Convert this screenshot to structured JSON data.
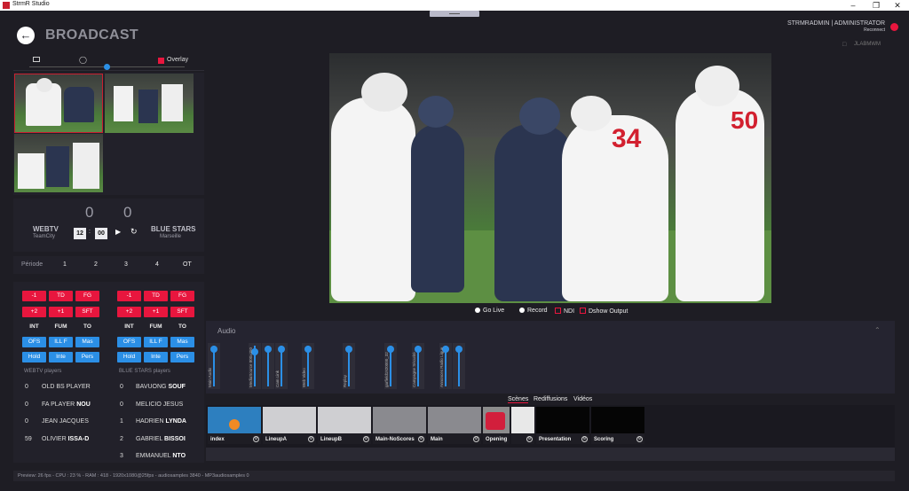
{
  "window": {
    "title": "StrmR Studio",
    "min": "–",
    "max": "❐",
    "close": "✕"
  },
  "header": {
    "title": "BROADCAST",
    "user": "STRMRADMIN | ADMINISTRATOR",
    "reconnect": "Reconnect",
    "status_color": "#e8163e"
  },
  "right_info": {
    "code": "JLABMWM"
  },
  "sources": {
    "overlay_label": "Overlay"
  },
  "scoreboard": {
    "home": {
      "name": "WEBTV",
      "city": "TeamCity",
      "score": "0"
    },
    "away": {
      "name": "BLUE STARS",
      "city": "Marseille",
      "score": "0"
    },
    "clock_min": "12",
    "clock_sec": "00"
  },
  "periode": {
    "label": "Période",
    "items": [
      "1",
      "2",
      "3",
      "4",
      "OT"
    ]
  },
  "actions": {
    "rows": [
      [
        "-1",
        "TD",
        "FG"
      ],
      [
        "+2",
        "+1",
        "SFT"
      ],
      [
        "INT",
        "FUM",
        "TO"
      ],
      [
        "OFS",
        "ILL F",
        "Mas"
      ],
      [
        "Hold",
        "Inte",
        "Pers"
      ]
    ]
  },
  "home_players": {
    "title": "WEBTV players",
    "list": [
      {
        "num": "0",
        "first": "OLD BS PLAYER",
        "last": ""
      },
      {
        "num": "0",
        "first": "FA PLAYER",
        "last": "NOU"
      },
      {
        "num": "0",
        "first": "JEAN JACQUES",
        "last": ""
      },
      {
        "num": "59",
        "first": "OLIVIER",
        "last": "ISSA-D"
      }
    ]
  },
  "away_players": {
    "title": "BLUE STARS players",
    "list": [
      {
        "num": "0",
        "first": "BAVUONG",
        "last": "SOUF"
      },
      {
        "num": "0",
        "first": "MELICIO JESUS",
        "last": ""
      },
      {
        "num": "1",
        "first": "HADRIEN",
        "last": "LYNDA"
      },
      {
        "num": "2",
        "first": "GABRIEL",
        "last": "BISSOI"
      },
      {
        "num": "3",
        "first": "EMMANUEL",
        "last": "NTO"
      }
    ]
  },
  "outputs": {
    "go_live": "Go Live",
    "record": "Record",
    "ndi": "NDI",
    "dshow": "Dshow Output"
  },
  "audio": {
    "title": "Audio",
    "channels": [
      {
        "label": "Main Audio",
        "level": 0.02
      },
      {
        "label": "MediaSource 800x450",
        "level": 0.1
      },
      {
        "label": "Cam Link",
        "level": 0.02
      },
      {
        "label": "Web Video",
        "level": 0.02
      },
      {
        "label": "Replay",
        "level": 0.02
      },
      {
        "label": "garfield1920000_32",
        "level": 0.02
      },
      {
        "label": "Campagne Sécurité",
        "level": 0.02
      },
      {
        "label": "Annonces Radio Ligue",
        "level": 0.02
      },
      {
        "label": "",
        "level": 0.02
      }
    ]
  },
  "scene_tabs": [
    "Scènes",
    "Rediffusions",
    "Vidéos"
  ],
  "scenes": [
    {
      "name": "index",
      "bg": "#2d7fbf"
    },
    {
      "name": "LineupA",
      "bg": "#cfcfd2"
    },
    {
      "name": "LineupB",
      "bg": "#cfcfd2"
    },
    {
      "name": "Main-NoScores",
      "bg": "#8a8a8f"
    },
    {
      "name": "Main",
      "bg": "#8a8a8f"
    },
    {
      "name": "Opening",
      "bg": "#8c8c8c"
    },
    {
      "name": "",
      "bg": "#e8e8e8"
    },
    {
      "name": "Presentation",
      "bg": "#050505"
    },
    {
      "name": "Scoring",
      "bg": "#050505"
    }
  ],
  "statusbar": "Preview: 26 fps - CPU : 23 % - RAM : 418 - 1920x1080@25fps - audiosamples 3840 - MP3audiosamples 0"
}
